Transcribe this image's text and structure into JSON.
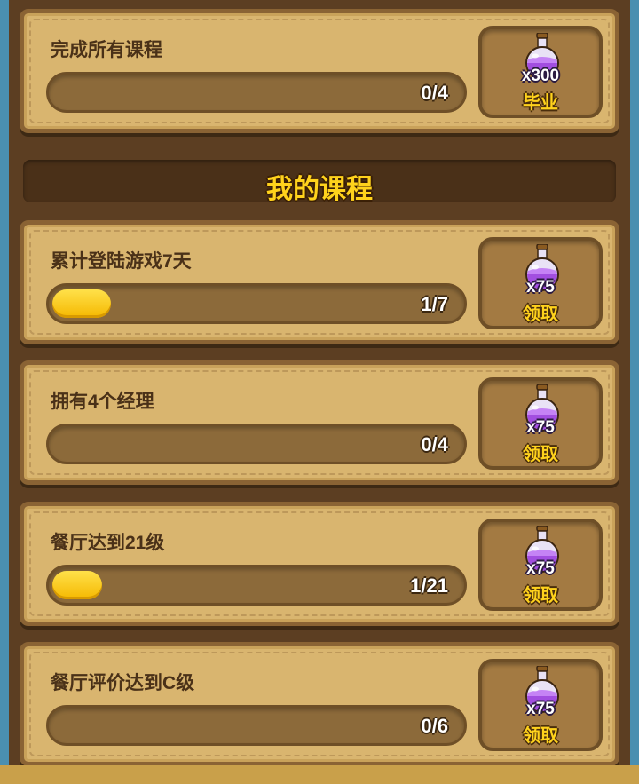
{
  "top_task": {
    "title": "完成所有课程",
    "progress_text": "0/4",
    "progress_fraction": 0,
    "reward": {
      "icon": "potion-icon",
      "quantity": "x300",
      "label": "毕业"
    }
  },
  "section": {
    "title": "我的课程"
  },
  "courses": [
    {
      "title": "累计登陆游戏7天",
      "progress_text": "1/7",
      "progress_fraction": 0.143,
      "reward": {
        "icon": "potion-icon",
        "quantity": "x75",
        "label": "领取"
      }
    },
    {
      "title": "拥有4个经理",
      "progress_text": "0/4",
      "progress_fraction": 0,
      "reward": {
        "icon": "potion-icon",
        "quantity": "x75",
        "label": "领取"
      }
    },
    {
      "title": "餐厅达到21级",
      "progress_text": "1/21",
      "progress_fraction": 0.048,
      "reward": {
        "icon": "potion-icon",
        "quantity": "x75",
        "label": "领取"
      }
    },
    {
      "title": "餐厅评价达到C级",
      "progress_text": "0/6",
      "progress_fraction": 0,
      "reward": {
        "icon": "potion-icon",
        "quantity": "x75",
        "label": "领取"
      }
    }
  ],
  "colors": {
    "card_bg": "#d9b56f",
    "progress_fill": "#f5b800",
    "section_title": "#ffd21c",
    "potion_liquid": "#a24ee0"
  }
}
